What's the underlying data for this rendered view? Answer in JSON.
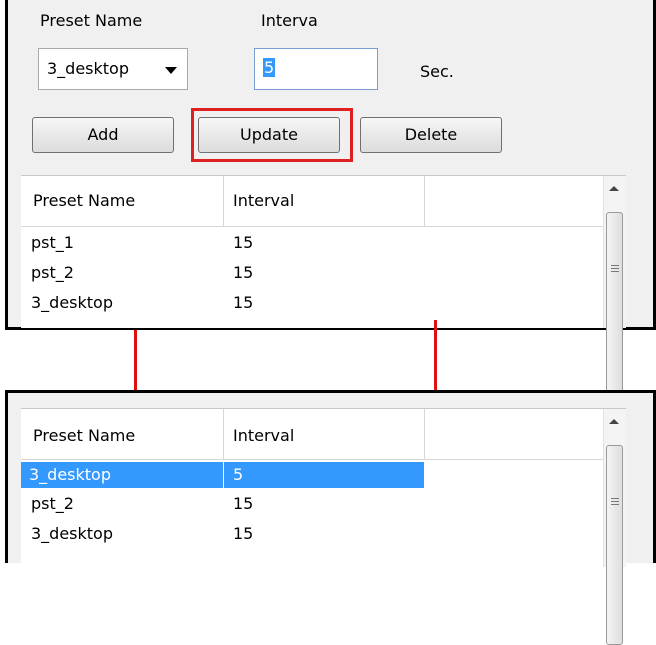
{
  "form": {
    "preset_label": "Preset Name",
    "interval_label": "Interva",
    "preset_value": "3_desktop",
    "interval_value": "5",
    "unit": "Sec.",
    "buttons": {
      "add": "Add",
      "update": "Update",
      "delete": "Delete"
    }
  },
  "table_before": {
    "headers": [
      "Preset Name",
      "Interval"
    ],
    "rows": [
      [
        "pst_1",
        "15"
      ],
      [
        "pst_2",
        "15"
      ],
      [
        "3_desktop",
        "15"
      ]
    ]
  },
  "table_after": {
    "headers": [
      "Preset Name",
      "Interval"
    ],
    "rows": [
      [
        "3_desktop",
        "5"
      ],
      [
        "pst_2",
        "15"
      ],
      [
        "3_desktop",
        "15"
      ]
    ],
    "selected_row": 0
  },
  "colors": {
    "highlight_box": "#e02020",
    "arrows": "#e01010",
    "selection": "#3399ff"
  },
  "icons": [
    "chevron-down-icon",
    "scroll-up-icon",
    "scroll-grip-icon",
    "down-arrow-icon"
  ]
}
